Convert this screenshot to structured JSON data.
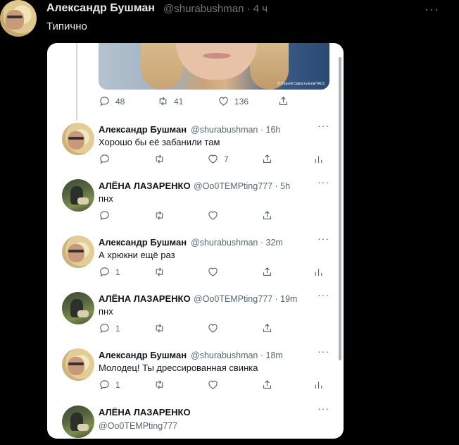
{
  "outer_tweet": {
    "author_name": "Александр Бушман",
    "author_handle": "@shurabushman · 4 ч",
    "text": "Типично",
    "more": "···"
  },
  "embedded": {
    "photo_credit": "© Сергей Савостьянов/ТАСС",
    "top_actions": {
      "replies": "48",
      "retweets": "41",
      "likes": "136"
    },
    "replies": [
      {
        "name": "Александр Бушман",
        "handle": "@shurabushman · 16h",
        "text": "Хорошо бы её забанили там",
        "reply_count": "",
        "like_count": "7",
        "author": "alex"
      },
      {
        "name": "АЛЁНА ЛАЗАРЕНКО",
        "handle": "@Oo0TEMPting777 · 5h",
        "text": "пнх",
        "reply_count": "",
        "like_count": "",
        "author": "alena"
      },
      {
        "name": "Александр Бушман",
        "handle": "@shurabushman · 32m",
        "text": "А хрюкни ещё раз",
        "reply_count": "1",
        "like_count": "",
        "author": "alex"
      },
      {
        "name": "АЛЁНА ЛАЗАРЕНКО",
        "handle": "@Oo0TEMPting777 · 19m",
        "text": "пнх",
        "reply_count": "1",
        "like_count": "",
        "author": "alena"
      },
      {
        "name": "Александр Бушман",
        "handle": "@shurabushman · 18m",
        "text": "Молодец! Ты дрессированная свинка",
        "reply_count": "1",
        "like_count": "",
        "author": "alex"
      },
      {
        "name": "АЛЁНА ЛАЗАРЕНКО",
        "handle": "@Oo0TEMPting777",
        "text": "",
        "reply_count": "",
        "like_count": "",
        "author": "alena"
      }
    ],
    "more": "···"
  }
}
